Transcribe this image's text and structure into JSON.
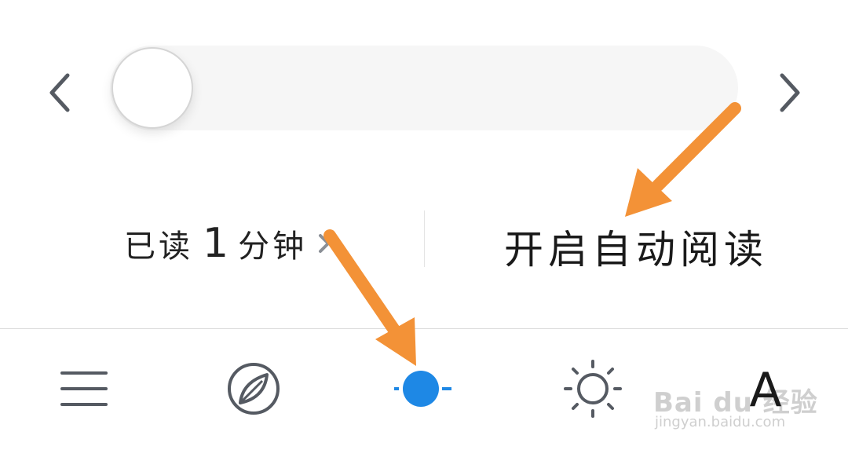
{
  "progress": {
    "prev_label": "‹",
    "next_label": "›",
    "position": 0
  },
  "read_time": {
    "prefix": "已读",
    "minutes": "1",
    "suffix": "分钟"
  },
  "auto_read": {
    "label": "开启自动阅读"
  },
  "toolbar": {
    "items": [
      "menu-icon",
      "compass-icon",
      "night-mode-dot-icon",
      "brightness-icon",
      "font-size-icon"
    ],
    "font_label": "A"
  },
  "colors": {
    "accent": "#1e88e5",
    "arrow": "#f39237",
    "icon": "#555a62",
    "track": "#f6f6f6"
  },
  "watermark": {
    "brand": "Bai du 经验",
    "url": "jingyan.baidu.com"
  }
}
